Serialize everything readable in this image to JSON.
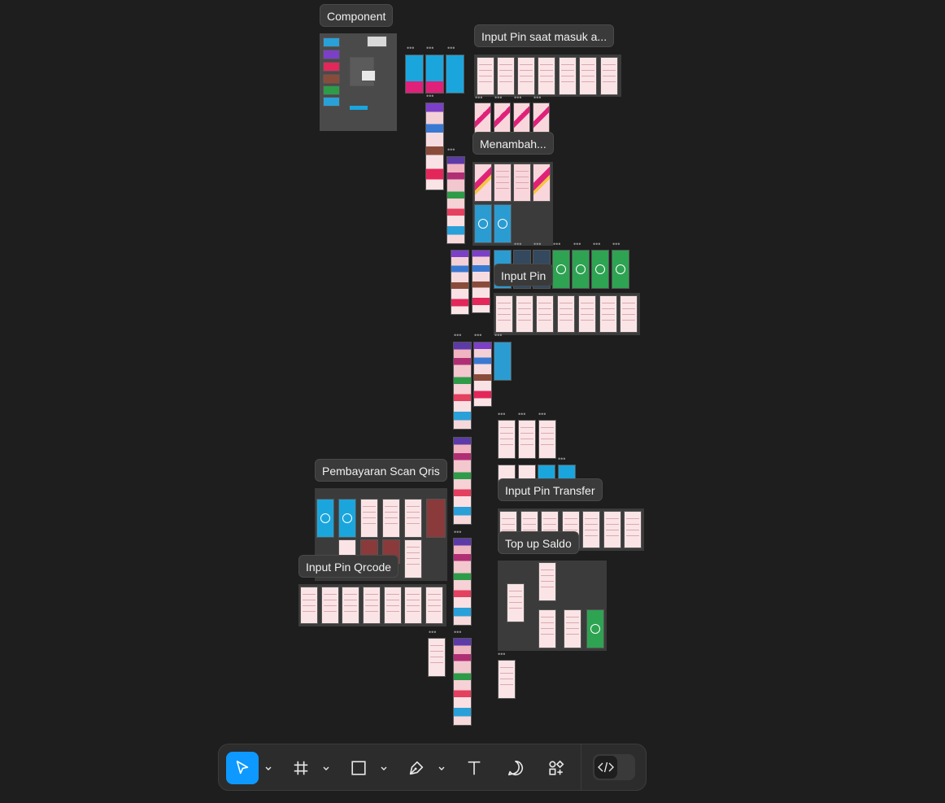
{
  "canvas": {
    "labels": {
      "component": "Component",
      "input_pin_masuk": "Input Pin saat masuk a...",
      "menambah": "Menambah...",
      "input_pin": "Input Pin",
      "pembayaran_scan_qris": "Pembayaran Scan Qris",
      "input_pin_transfer": "Input Pin Transfer",
      "input_pin_qrcode": "Input Pin Qrcode",
      "top_up_saldo": "Top up Saldo"
    },
    "more_indicator": "•••"
  },
  "toolbar": {
    "tools": [
      {
        "name": "move-tool",
        "icon": "cursor-icon",
        "active": true
      },
      {
        "name": "frame-tool",
        "icon": "frame-hash-icon",
        "active": false
      },
      {
        "name": "shape-tool",
        "icon": "rectangle-icon",
        "active": false
      },
      {
        "name": "pen-tool",
        "icon": "pen-icon",
        "active": false
      },
      {
        "name": "text-tool",
        "icon": "text-T-icon",
        "active": false
      },
      {
        "name": "comment-tool",
        "icon": "comment-bubble-icon",
        "active": false
      },
      {
        "name": "actions-tool",
        "icon": "plugins-shapes-icon",
        "active": false
      }
    ],
    "dev_mode_icon": "code-brackets-icon"
  },
  "colors": {
    "canvas_bg": "#1e1e1e",
    "toolbar_bg": "#2c2c2c",
    "accent": "#0d99ff",
    "label_bg": "#3a3a3a"
  }
}
